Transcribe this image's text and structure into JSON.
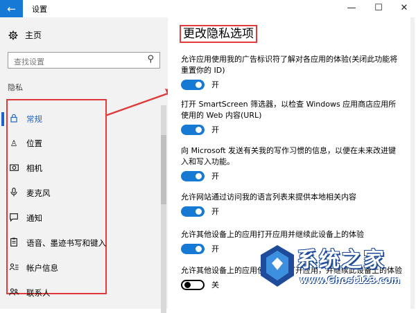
{
  "window": {
    "title": "设置",
    "back_icon": "←",
    "minimize": "—",
    "maximize": "☐",
    "close": "✕"
  },
  "sidebar": {
    "home_label": "主页",
    "search_placeholder": "查找设置",
    "section_label": "隐私",
    "items": [
      {
        "label": "常规",
        "icon": "lock-icon",
        "active": true
      },
      {
        "label": "位置",
        "icon": "location-icon"
      },
      {
        "label": "相机",
        "icon": "camera-icon"
      },
      {
        "label": "麦克风",
        "icon": "microphone-icon"
      },
      {
        "label": "通知",
        "icon": "notification-icon"
      },
      {
        "label": "语音、墨迹书写和键入",
        "icon": "clipboard-icon"
      },
      {
        "label": "帐户信息",
        "icon": "account-info-icon"
      },
      {
        "label": "联系人",
        "icon": "contacts-icon"
      }
    ]
  },
  "main": {
    "title": "更改隐私选项",
    "settings": [
      {
        "desc": "允许应用使用我的广告标识符了解对各应用的体验(关闭此功能将重置你的 ID)",
        "state": "开",
        "on": true
      },
      {
        "desc": "打开 SmartScreen 筛选器，以检查 Windows 应用商店应用所使用的 Web 内容(URL)",
        "state": "开",
        "on": true
      },
      {
        "desc": "向 Microsoft 发送有关我的写作习惯的信息，以便在未来改进键入和写入功能。",
        "state": "开",
        "on": true
      },
      {
        "desc": "允许网站通过访问我的语言列表来提供本地相关内容",
        "state": "开",
        "on": true
      },
      {
        "desc": "允许其他设备上的应用打开应用并继续此设备上的体验",
        "state": "开",
        "on": true
      },
      {
        "desc": "允许其他设备上的应用使用蓝牙打开应用，并继续此设备上的体验",
        "state": "关",
        "on": false
      }
    ]
  },
  "watermark": {
    "title": "系统之家",
    "url": "www.Ghost123.com"
  },
  "colors": {
    "accent": "#1679d3",
    "annotation": "#e03a3a",
    "sidebar_bg": "#f2f2f2"
  }
}
